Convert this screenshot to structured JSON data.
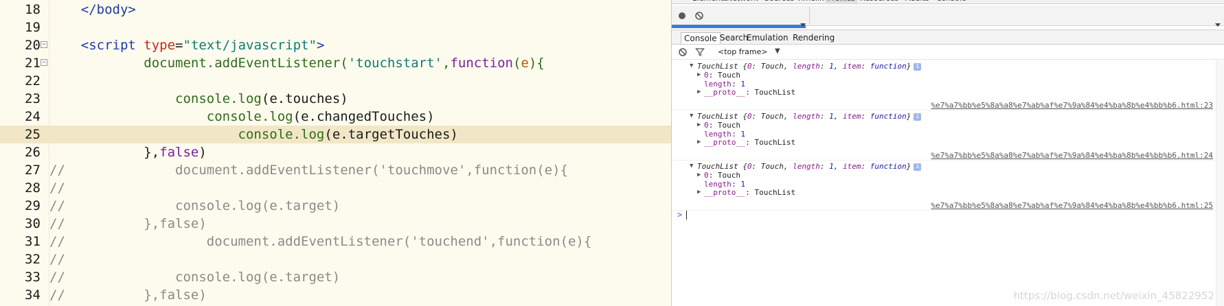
{
  "editor": {
    "lines": [
      {
        "num": "18",
        "fold": "",
        "tokens": [
          [
            "plain",
            "    "
          ],
          [
            "tag",
            "</body>"
          ]
        ]
      },
      {
        "num": "19",
        "fold": "",
        "tokens": []
      },
      {
        "num": "20",
        "fold": "−",
        "tokens": [
          [
            "plain",
            "    "
          ],
          [
            "tag",
            "<script "
          ],
          [
            "attr",
            "type"
          ],
          [
            "plain",
            "="
          ],
          [
            "str",
            "\"text/javascript\""
          ],
          [
            "tag",
            ">"
          ]
        ]
      },
      {
        "num": "21",
        "fold": "−",
        "tokens": [
          [
            "plain",
            "            "
          ],
          [
            "fn",
            "document.addEventListener("
          ],
          [
            "str",
            "'touchstart'"
          ],
          [
            "fn",
            ","
          ],
          [
            "kw",
            "function"
          ],
          [
            "fn",
            "("
          ],
          [
            "param",
            "e"
          ],
          [
            "fn",
            "){"
          ]
        ]
      },
      {
        "num": "22",
        "fold": "",
        "tokens": []
      },
      {
        "num": "23",
        "fold": "",
        "tokens": [
          [
            "plain",
            "                "
          ],
          [
            "fn",
            "console.log"
          ],
          [
            "plain",
            "(e.touches)"
          ]
        ]
      },
      {
        "num": "24",
        "fold": "",
        "tokens": [
          [
            "plain",
            "                    "
          ],
          [
            "fn",
            "console.log"
          ],
          [
            "plain",
            "(e.changedTouches)"
          ]
        ]
      },
      {
        "num": "25",
        "fold": "",
        "current": true,
        "tokens": [
          [
            "plain",
            "                        "
          ],
          [
            "fn",
            "console.log"
          ],
          [
            "plain",
            "(e.targetTouches)"
          ]
        ]
      },
      {
        "num": "26",
        "fold": "",
        "tokens": [
          [
            "plain",
            "            "
          ],
          [
            "plain",
            "},"
          ],
          [
            "kw",
            "false"
          ],
          [
            "plain",
            ")"
          ]
        ]
      },
      {
        "num": "27",
        "fold": "",
        "tokens": [
          [
            "cmt",
            "//              document.addEventListener('touchmove',function(e){"
          ]
        ]
      },
      {
        "num": "28",
        "fold": "",
        "tokens": [
          [
            "cmt",
            "//"
          ]
        ]
      },
      {
        "num": "29",
        "fold": "",
        "tokens": [
          [
            "cmt",
            "//              console.log(e.target)"
          ]
        ]
      },
      {
        "num": "30",
        "fold": "",
        "tokens": [
          [
            "cmt",
            "//          },false)"
          ]
        ]
      },
      {
        "num": "31",
        "fold": "",
        "tokens": [
          [
            "cmt",
            "//                  document.addEventListener('touchend',function(e){"
          ]
        ]
      },
      {
        "num": "32",
        "fold": "",
        "tokens": [
          [
            "cmt",
            "//"
          ]
        ]
      },
      {
        "num": "33",
        "fold": "",
        "tokens": [
          [
            "cmt",
            "//              console.log(e.target)"
          ]
        ]
      },
      {
        "num": "34",
        "fold": "",
        "tokens": [
          [
            "cmt",
            "//          },false)"
          ]
        ]
      }
    ]
  },
  "devtools": {
    "top_tabs": [
      "Elements",
      "Network",
      "Sources",
      "Timeline",
      "Profiles",
      "Resources",
      "Audits",
      "Console"
    ],
    "active_top_tab": "Profiles",
    "drawer_tabs": [
      "Console",
      "Search",
      "Emulation",
      "Rendering"
    ],
    "selected_drawer_tab": "Console",
    "frame_selector": "<top frame>",
    "messages": [
      {
        "summary_prefix": "TouchList {",
        "summary_items": [
          [
            "0",
            "Touch"
          ],
          [
            "length",
            "1"
          ],
          [
            "item",
            "function"
          ]
        ],
        "summary_suffix": "}",
        "rows": [
          {
            "key": "0",
            "value": ": Touch",
            "expandable": true
          },
          {
            "key": "length",
            "value": ": 1",
            "expandable": false
          },
          {
            "key": "__proto__",
            "value": ": TouchList",
            "expandable": true
          }
        ],
        "source": "%e7%a7%bb%e5%8a%a8%e7%ab%af%e7%9a%84%e4%ba%8b%e4%bb%b6.html:23"
      },
      {
        "summary_prefix": "TouchList {",
        "summary_items": [
          [
            "0",
            "Touch"
          ],
          [
            "length",
            "1"
          ],
          [
            "item",
            "function"
          ]
        ],
        "summary_suffix": "}",
        "rows": [
          {
            "key": "0",
            "value": ": Touch",
            "expandable": true
          },
          {
            "key": "length",
            "value": ": 1",
            "expandable": false
          },
          {
            "key": "__proto__",
            "value": ": TouchList",
            "expandable": true
          }
        ],
        "source": "%e7%a7%bb%e5%8a%a8%e7%ab%af%e7%9a%84%e4%ba%8b%e4%bb%b6.html:24"
      },
      {
        "summary_prefix": "TouchList {",
        "summary_items": [
          [
            "0",
            "Touch"
          ],
          [
            "length",
            "1"
          ],
          [
            "item",
            "function"
          ]
        ],
        "summary_suffix": "}",
        "rows": [
          {
            "key": "0",
            "value": ": Touch",
            "expandable": true
          },
          {
            "key": "length",
            "value": ": 1",
            "expandable": false
          },
          {
            "key": "__proto__",
            "value": ": TouchList",
            "expandable": true
          }
        ],
        "source": "%e7%a7%bb%e5%8a%a8%e7%ab%af%e7%9a%84%e4%ba%8b%e4%bb%b6.html:25"
      }
    ],
    "prompt_symbol": ">"
  },
  "watermark": "https://blog.csdn.net/weixin_45822952",
  "colors": {
    "editor_bg": "#fdfbed",
    "current_line": "#f1e7c6",
    "accent_blue": "#3b7bd8"
  }
}
